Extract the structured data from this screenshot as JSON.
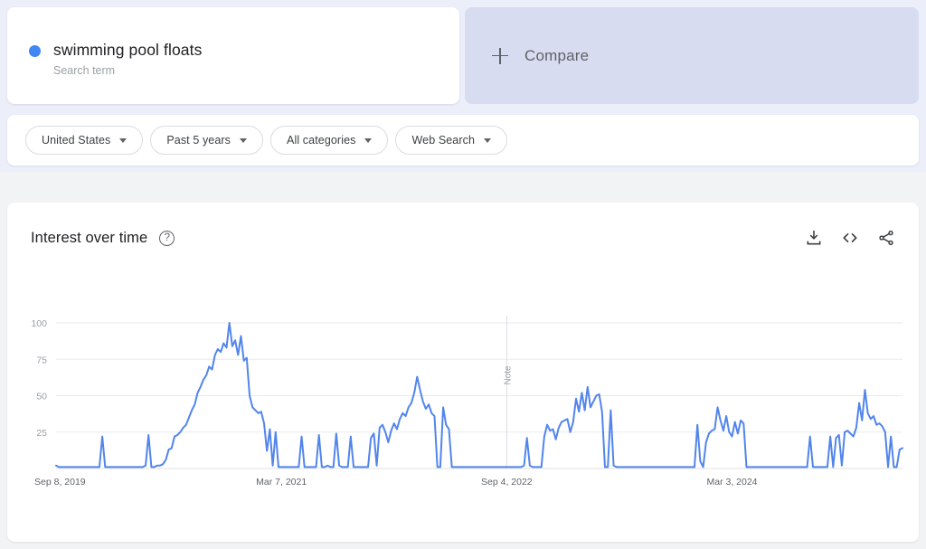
{
  "header": {
    "term": {
      "title": "swimming pool floats",
      "subtitle": "Search term",
      "dot_color": "#4285f4"
    },
    "compare": {
      "label": "Compare",
      "icon": "plus-icon"
    }
  },
  "filters": [
    {
      "label": "United States"
    },
    {
      "label": "Past 5 years"
    },
    {
      "label": "All categories"
    },
    {
      "label": "Web Search"
    }
  ],
  "chart_card": {
    "title": "Interest over time",
    "help_icon": "?",
    "actions": [
      {
        "name": "download-icon"
      },
      {
        "name": "embed-icon"
      },
      {
        "name": "share-icon"
      }
    ],
    "note_label": "Note"
  },
  "chart_data": {
    "type": "line",
    "title": "Interest over time",
    "xlabel": "",
    "ylabel": "",
    "ylim": [
      0,
      100
    ],
    "grid": true,
    "legend": false,
    "line_color": "#5285ec",
    "axis_tick_labels_y": [
      "100",
      "75",
      "50",
      "25"
    ],
    "y_ticks": [
      100,
      75,
      50,
      25
    ],
    "x_tick_labels": [
      "Sep 8, 2019",
      "Mar 7, 2021",
      "Sep 4, 2022",
      "Mar 3, 2024"
    ],
    "x_tick_positions": [
      0,
      78,
      156,
      234
    ],
    "annotations": [
      {
        "label": "Note",
        "x_index": 156,
        "orientation": "vertical"
      }
    ],
    "series": [
      {
        "name": "swimming pool floats",
        "color": "#5285ec",
        "values": [
          2,
          1,
          1,
          1,
          1,
          1,
          1,
          1,
          1,
          1,
          1,
          1,
          1,
          1,
          1,
          1,
          22,
          1,
          1,
          1,
          1,
          1,
          1,
          1,
          1,
          1,
          1,
          1,
          1,
          1,
          1,
          2,
          23,
          1,
          1,
          2,
          2,
          3,
          6,
          13,
          14,
          22,
          23,
          25,
          28,
          30,
          35,
          40,
          44,
          52,
          56,
          61,
          64,
          70,
          68,
          78,
          82,
          80,
          86,
          83,
          100,
          84,
          88,
          78,
          91,
          74,
          76,
          50,
          42,
          40,
          38,
          39,
          31,
          12,
          27,
          2,
          25,
          1,
          1,
          1,
          1,
          1,
          1,
          1,
          1,
          22,
          1,
          1,
          1,
          1,
          1,
          23,
          1,
          1,
          2,
          1,
          1,
          24,
          2,
          1,
          1,
          1,
          22,
          1,
          1,
          1,
          1,
          1,
          1,
          21,
          24,
          2,
          28,
          30,
          25,
          18,
          26,
          31,
          27,
          34,
          38,
          36,
          42,
          45,
          52,
          63,
          54,
          46,
          41,
          44,
          38,
          36,
          1,
          1,
          42,
          30,
          27,
          1,
          1,
          1,
          1,
          1,
          1,
          1,
          1,
          1,
          1,
          1,
          1,
          1,
          1,
          1,
          1,
          1,
          1,
          1,
          1,
          1,
          1,
          1,
          1,
          1,
          2,
          21,
          2,
          1,
          1,
          1,
          1,
          22,
          30,
          26,
          27,
          20,
          28,
          32,
          33,
          34,
          25,
          32,
          48,
          39,
          52,
          40,
          56,
          42,
          46,
          50,
          51,
          39,
          1,
          1,
          40,
          2,
          1,
          1,
          1,
          1,
          1,
          1,
          1,
          1,
          1,
          1,
          1,
          1,
          1,
          1,
          1,
          1,
          1,
          1,
          1,
          1,
          1,
          1,
          1,
          1,
          1,
          1,
          1,
          1,
          30,
          5,
          1,
          18,
          24,
          26,
          27,
          42,
          33,
          26,
          36,
          25,
          22,
          32,
          24,
          33,
          31,
          1,
          1,
          1,
          1,
          1,
          1,
          1,
          1,
          1,
          1,
          1,
          1,
          1,
          1,
          1,
          1,
          1,
          1,
          1,
          1,
          1,
          1,
          22,
          1,
          1,
          1,
          1,
          1,
          1,
          22,
          1,
          21,
          23,
          2,
          25,
          26,
          24,
          22,
          28,
          45,
          33,
          54,
          38,
          34,
          36,
          30,
          31,
          29,
          25,
          1,
          22,
          1,
          1,
          13,
          14
        ]
      }
    ]
  }
}
